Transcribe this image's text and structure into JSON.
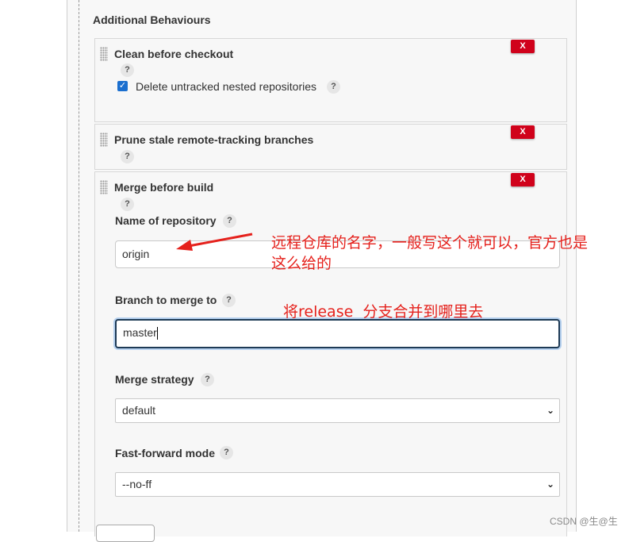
{
  "section": {
    "title": "Additional Behaviours"
  },
  "behaviours": {
    "clean": {
      "title": "Clean before checkout",
      "delete_label": "X",
      "help": "?",
      "checkbox_label": "Delete untracked nested repositories",
      "checkbox_checked": true
    },
    "prune": {
      "title": "Prune stale remote-tracking branches",
      "delete_label": "X",
      "help": "?"
    },
    "merge": {
      "title": "Merge before build",
      "delete_label": "X",
      "help": "?",
      "repo_label": "Name of repository",
      "repo_value": "origin",
      "branch_label": "Branch to merge to",
      "branch_value": "master",
      "strategy_label": "Merge strategy",
      "strategy_value": "default",
      "ff_label": "Fast-forward mode",
      "ff_value": "--no-ff"
    }
  },
  "annotations": {
    "repo_note_line1": "远程仓库的名字，一般写这个就可以，官方也是",
    "repo_note_line2": "这么给的",
    "branch_note": "将release  分支合并到哪里去"
  },
  "colors": {
    "delete": "#d0021b",
    "annotation": "#e5211c",
    "checkbox": "#1b6fcf"
  },
  "watermark": "CSDN @生@生"
}
